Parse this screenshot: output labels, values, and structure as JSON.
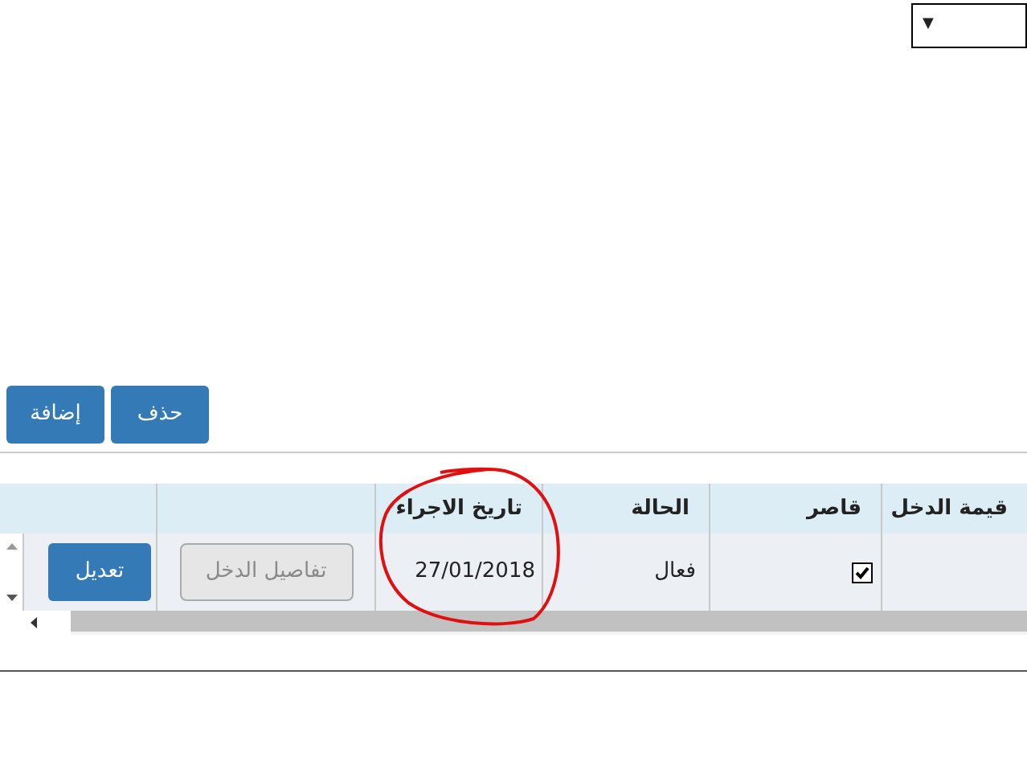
{
  "top_select": {
    "arrow": "▼"
  },
  "toolbar": [
    {
      "label": "حذف"
    },
    {
      "label": "إضافة"
    }
  ],
  "table": {
    "columns": [
      "قيمة الدخل",
      "قاصر",
      "الحالة",
      "تاريخ الاجراء"
    ],
    "rows": [
      {
        "minor_checked": true,
        "status": "فعال",
        "date": "27/01/2018",
        "details_button": {
          "label": "تفاصيل الدخل",
          "disabled": true
        },
        "edit_button": "تعديل"
      }
    ]
  }
}
